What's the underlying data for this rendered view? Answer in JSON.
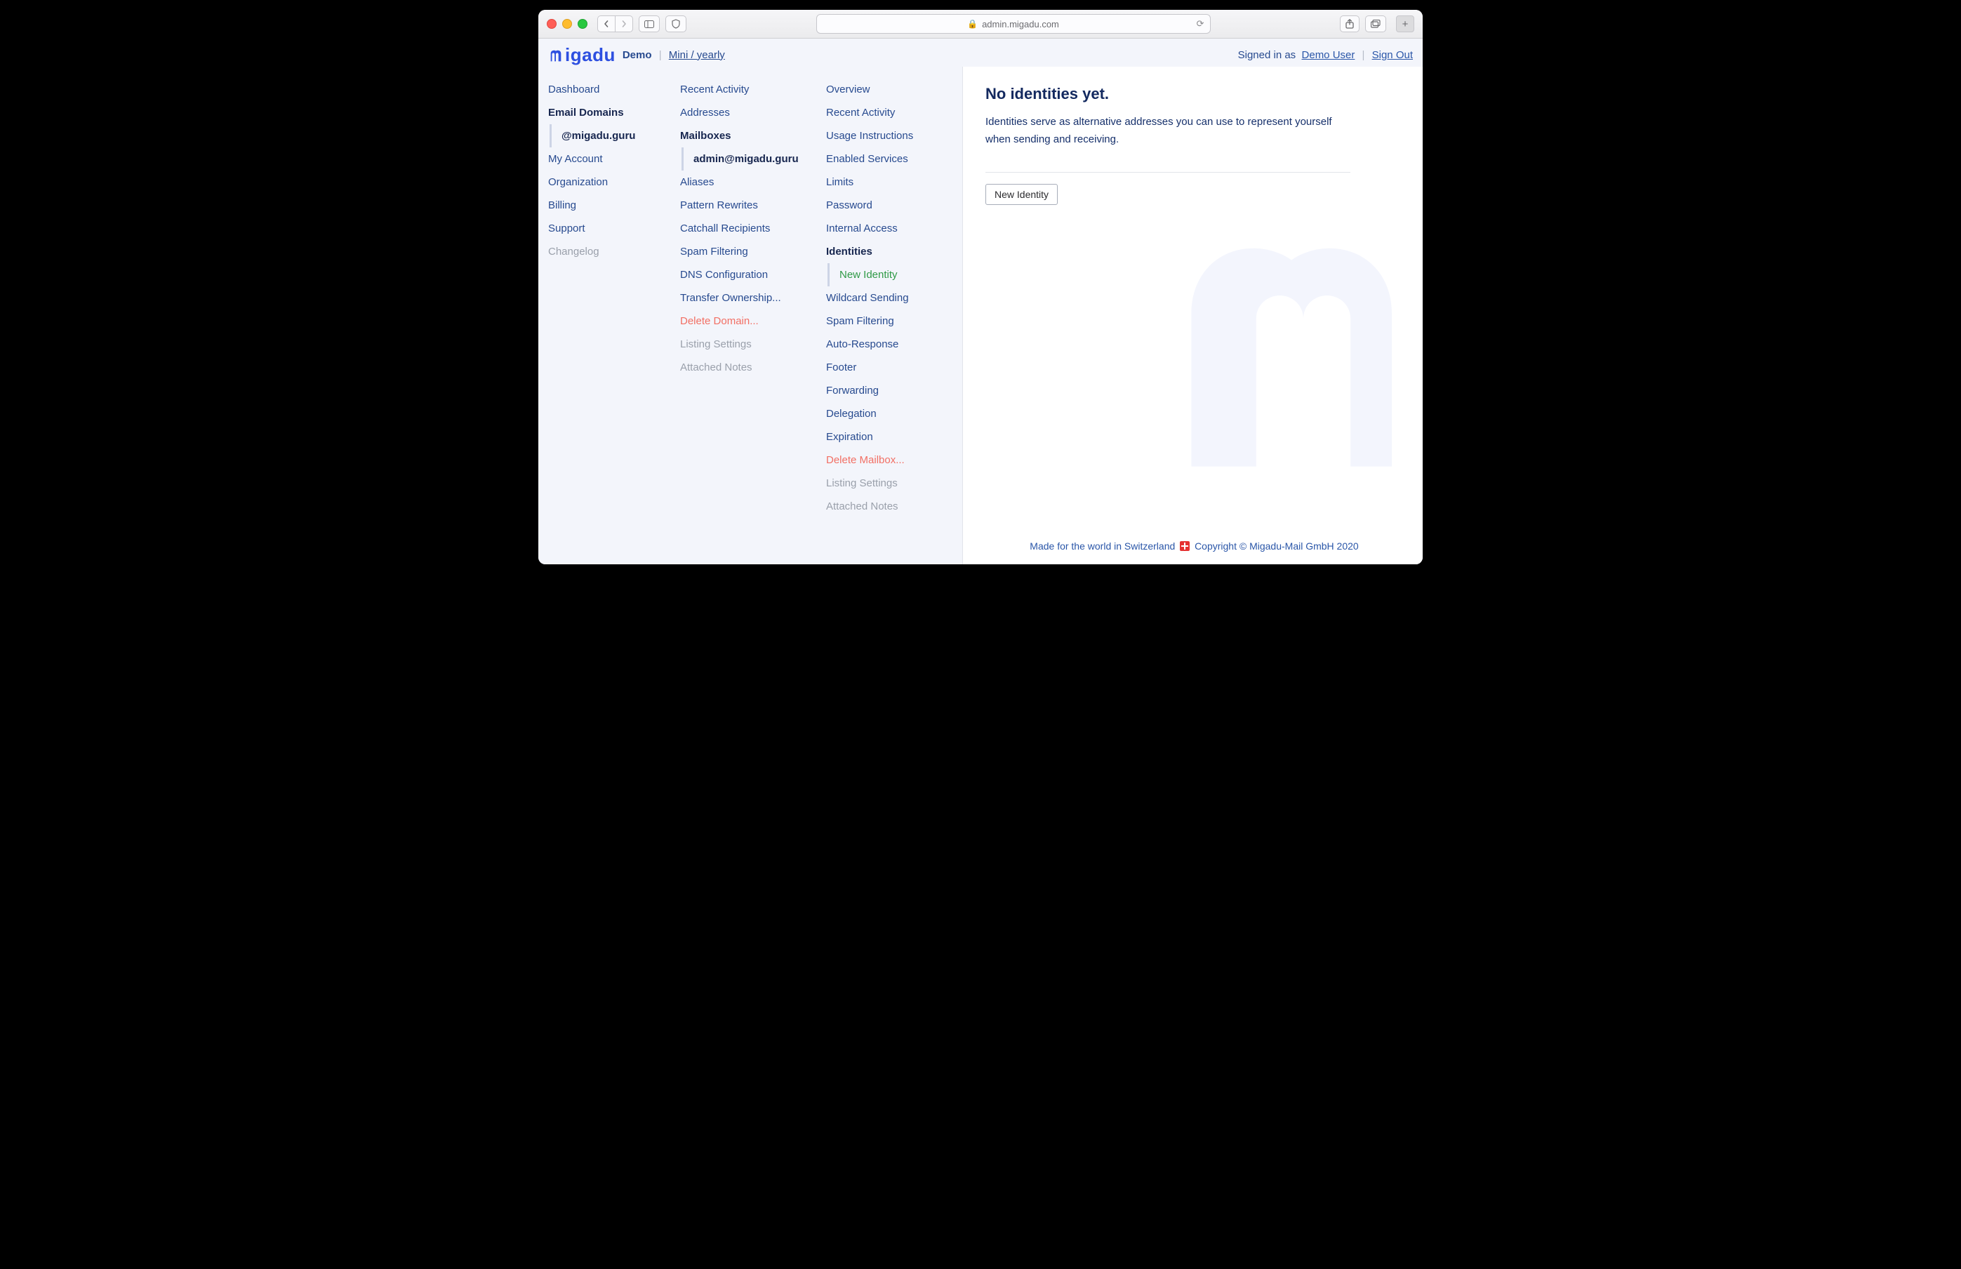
{
  "browser": {
    "url_host": "admin.migadu.com"
  },
  "header": {
    "logo_text": "igadu",
    "demo_label": "Demo",
    "plan_link": "Mini / yearly",
    "signed_in_prefix": "Signed in as",
    "user_name": "Demo User",
    "sign_out": "Sign Out"
  },
  "nav1": {
    "dashboard": "Dashboard",
    "email_domains": "Email Domains",
    "domain_sub": "@migadu.guru",
    "my_account": "My Account",
    "organization": "Organization",
    "billing": "Billing",
    "support": "Support",
    "changelog": "Changelog"
  },
  "nav2": {
    "recent_activity": "Recent Activity",
    "addresses": "Addresses",
    "mailboxes": "Mailboxes",
    "mailbox_sub": "admin@migadu.guru",
    "aliases": "Aliases",
    "pattern_rewrites": "Pattern Rewrites",
    "catchall": "Catchall Recipients",
    "spam_filtering": "Spam Filtering",
    "dns_config": "DNS Configuration",
    "transfer_ownership": "Transfer Ownership...",
    "delete_domain": "Delete Domain...",
    "listing_settings": "Listing Settings",
    "attached_notes": "Attached Notes"
  },
  "nav3": {
    "overview": "Overview",
    "recent_activity": "Recent Activity",
    "usage": "Usage Instructions",
    "enabled_services": "Enabled Services",
    "limits": "Limits",
    "password": "Password",
    "internal_access": "Internal Access",
    "identities": "Identities",
    "new_identity_sub": "New Identity",
    "wildcard_sending": "Wildcard Sending",
    "spam_filtering": "Spam Filtering",
    "auto_response": "Auto-Response",
    "footer": "Footer",
    "forwarding": "Forwarding",
    "delegation": "Delegation",
    "expiration": "Expiration",
    "delete_mailbox": "Delete Mailbox...",
    "listing_settings": "Listing Settings",
    "attached_notes": "Attached Notes"
  },
  "main": {
    "heading": "No identities yet.",
    "body_line1": "Identities serve as alternative addresses you can use to represent yourself",
    "body_line2": "when sending and receiving.",
    "new_identity_btn": "New Identity"
  },
  "footer": {
    "left": "Made for the world in Switzerland",
    "right": "Copyright © Migadu-Mail GmbH 2020"
  }
}
